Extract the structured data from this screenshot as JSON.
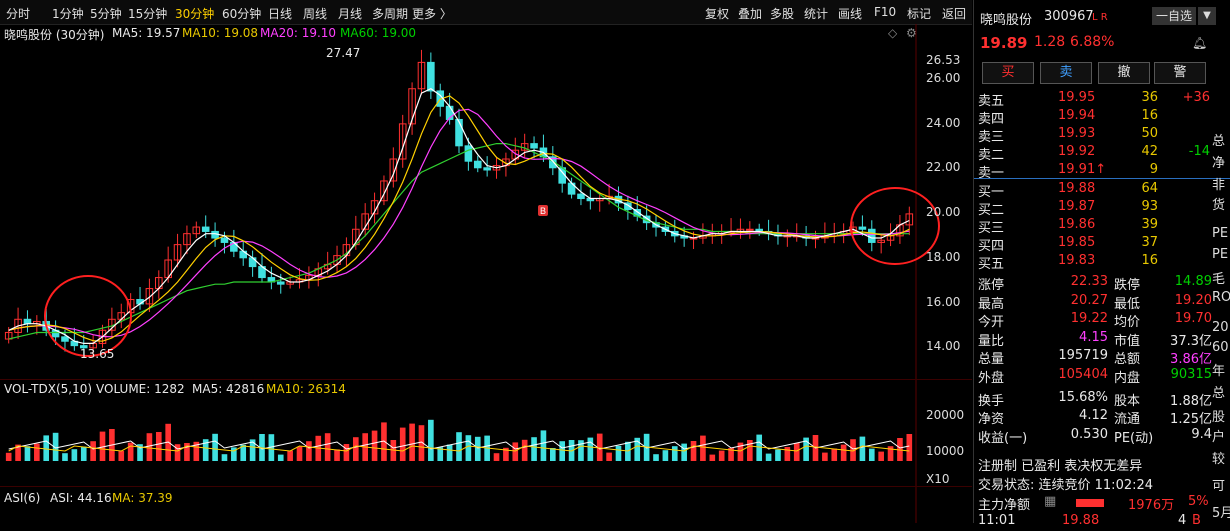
{
  "toolbar": {
    "left": [
      "分时",
      "1分钟",
      "5分钟",
      "15分钟",
      "30分钟",
      "60分钟",
      "日线",
      "周线",
      "月线",
      "多周期",
      "更多 〉"
    ],
    "active": "30分钟",
    "right": [
      "复权",
      "叠加",
      "多股",
      "统计",
      "画线",
      "F10",
      "标记",
      "返回"
    ]
  },
  "main_legend": {
    "title": "晓鸣股份 (30分钟)",
    "ma5": "MA5: 19.57",
    "ma10": "MA10: 19.08",
    "ma20": "MA20: 19.10",
    "ma60": "MA60: 19.00"
  },
  "vol_legend": {
    "name": "VOL-TDX(5,10)",
    "volume": "VOLUME: 1282",
    "ma5": "MA5: 42816",
    "ma10": "MA10: 26314"
  },
  "asi_legend": {
    "name": "ASI(6)",
    "asi": "ASI: 44.16",
    "ma": "MA: 37.39"
  },
  "price_axis": [
    "26.53",
    "26.00",
    "24.00",
    "22.00",
    "20.00",
    "18.00",
    "16.00",
    "14.00"
  ],
  "vol_axis": [
    "20000",
    "10000",
    "X10"
  ],
  "annotations": {
    "high": "27.47",
    "low": "13.65",
    "marker": "B"
  },
  "colors": {
    "up": "#ff3030",
    "down": "#40e0e0",
    "ma5": "#ffffff",
    "ma10": "#ffd000",
    "ma20": "#ff40ff",
    "ma60": "#30d030",
    "circle": "#ff2020"
  },
  "chart_data": {
    "type": "candlestick",
    "timeframe": "30分钟",
    "ylim": [
      13.2,
      27.0
    ],
    "close": [
      14.5,
      15.1,
      14.9,
      15.0,
      14.6,
      14.3,
      14.1,
      13.9,
      13.8,
      14.0,
      14.6,
      15.1,
      15.4,
      16.0,
      15.8,
      16.5,
      17.0,
      17.8,
      18.5,
      19.0,
      19.3,
      19.1,
      18.8,
      18.6,
      18.2,
      17.9,
      17.5,
      17.0,
      16.8,
      16.7,
      16.8,
      16.9,
      17.1,
      17.4,
      17.6,
      18.0,
      18.5,
      19.2,
      19.9,
      20.5,
      21.4,
      22.4,
      24.0,
      25.6,
      26.8,
      25.5,
      24.8,
      24.2,
      23.0,
      22.3,
      22.0,
      21.9,
      22.1,
      22.4,
      22.8,
      23.1,
      22.9,
      22.5,
      22.0,
      21.3,
      20.8,
      20.6,
      20.5,
      20.6,
      20.7,
      20.4,
      20.1,
      19.8,
      19.5,
      19.3,
      19.1,
      18.9,
      18.8,
      18.8,
      18.9,
      19.0,
      19.1,
      19.1,
      19.2,
      19.2,
      19.1,
      19.0,
      18.9,
      18.9,
      18.9,
      18.8,
      18.8,
      18.9,
      19.0,
      19.1,
      19.3,
      19.2,
      18.6,
      18.7,
      18.9,
      19.4,
      19.9
    ],
    "ma5": [
      14.6,
      14.8,
      14.9,
      14.9,
      14.8,
      14.6,
      14.4,
      14.1,
      14.0,
      14.0,
      14.3,
      14.7,
      15.1,
      15.5,
      15.8,
      16.1,
      16.5,
      17.0,
      17.6,
      18.2,
      18.7,
      19.0,
      19.0,
      18.9,
      18.6,
      18.2,
      17.9,
      17.5,
      17.2,
      17.0,
      16.8,
      16.8,
      16.9,
      17.1,
      17.3,
      17.6,
      18.0,
      18.6,
      19.3,
      20.0,
      20.8,
      21.7,
      22.9,
      24.2,
      25.4,
      25.6,
      25.3,
      24.8,
      24.1,
      23.2,
      22.6,
      22.1,
      22.0,
      22.1,
      22.4,
      22.7,
      22.8,
      22.7,
      22.3,
      21.8,
      21.3,
      20.9,
      20.6,
      20.6,
      20.6,
      20.5,
      20.3,
      20.0,
      19.7,
      19.4,
      19.2,
      19.0,
      18.9,
      18.8,
      18.9,
      19.0,
      19.0,
      19.1,
      19.1,
      19.1,
      19.1,
      19.0,
      18.9,
      18.9,
      18.9,
      18.8,
      18.8,
      18.9,
      19.0,
      19.1,
      19.2,
      19.0,
      18.8,
      18.8,
      19.0,
      19.4,
      19.6
    ],
    "ma60": [
      14.2,
      14.3,
      14.4,
      14.5,
      14.5,
      14.5,
      14.5,
      14.5,
      14.5,
      14.6,
      14.7,
      14.8,
      15.0,
      15.2,
      15.4,
      15.6,
      15.8,
      16.0,
      16.2,
      16.4,
      16.5,
      16.6,
      16.7,
      16.7,
      16.8,
      16.8,
      16.8,
      16.8,
      16.8,
      16.9,
      17.0,
      17.1,
      17.2,
      17.4,
      17.6,
      17.8,
      18.1,
      18.5,
      18.9,
      19.4,
      19.9,
      20.4,
      20.9,
      21.4,
      21.8,
      22.0,
      22.2,
      22.4,
      22.6,
      22.8,
      22.9,
      23.0,
      23.1,
      23.1,
      23.0,
      22.9,
      22.7,
      22.5,
      22.3,
      22.0,
      21.7,
      21.4,
      21.1,
      20.8,
      20.5,
      20.2,
      20.0,
      19.8,
      19.6,
      19.5,
      19.4,
      19.3,
      19.2,
      19.2,
      19.2,
      19.1,
      19.1,
      19.1,
      19.1,
      19.0,
      19.0,
      19.0,
      19.0,
      19.0,
      19.0,
      19.0,
      19.0,
      19.0,
      19.0,
      19.0,
      19.0,
      19.0,
      19.0,
      19.0,
      19.0,
      19.0,
      19.0
    ]
  },
  "quote": {
    "name": "晓鸣股份",
    "code": "300967",
    "flags": "L R",
    "self_select": "一自选",
    "price": "19.89",
    "change": "1.28",
    "pct": "6.88%",
    "buttons": [
      "买",
      "卖",
      "撤",
      "警"
    ],
    "asks": [
      {
        "label": "卖五",
        "price": "19.95",
        "vol": "36",
        "chg": "+36"
      },
      {
        "label": "卖四",
        "price": "19.94",
        "vol": "16",
        "chg": ""
      },
      {
        "label": "卖三",
        "price": "19.93",
        "vol": "50",
        "chg": ""
      },
      {
        "label": "卖二",
        "price": "19.92",
        "vol": "42",
        "chg": "-14"
      },
      {
        "label": "卖一",
        "price": "19.91↑",
        "vol": "9",
        "chg": ""
      }
    ],
    "bids": [
      {
        "label": "买一",
        "price": "19.88",
        "vol": "64"
      },
      {
        "label": "买二",
        "price": "19.87",
        "vol": "93"
      },
      {
        "label": "买三",
        "price": "19.86",
        "vol": "39"
      },
      {
        "label": "买四",
        "price": "19.85",
        "vol": "37"
      },
      {
        "label": "买五",
        "price": "19.83",
        "vol": "16"
      }
    ],
    "stats": [
      [
        "涨停",
        "22.33",
        "跌停",
        "14.89"
      ],
      [
        "最高",
        "20.27",
        "最低",
        "19.20"
      ],
      [
        "今开",
        "19.22",
        "均价",
        "19.70"
      ],
      [
        "量比",
        "4.15",
        "市值",
        "37.3亿"
      ],
      [
        "总量",
        "195719",
        "总额",
        "3.86亿"
      ],
      [
        "外盘",
        "105404",
        "内盘",
        "90315"
      ],
      [
        "换手",
        "15.68%",
        "股本",
        "1.88亿"
      ],
      [
        "净资",
        "4.12",
        "流通",
        "1.25亿"
      ],
      [
        "收益(一)",
        "0.530",
        "PE(动)",
        "9.4"
      ]
    ],
    "tags": "注册制 已盈利 表决权无差异",
    "status": "交易状态: 连续竞价 11:02:24",
    "net_flow": {
      "label": "主力净额",
      "value": "1976万",
      "pct": "5%"
    },
    "tick": {
      "time": "11:01",
      "price": "19.88",
      "vol": "4",
      "side": "B"
    },
    "edge_text": [
      "总",
      "净",
      "非",
      "货",
      "PE",
      "PE",
      "毛",
      "RO",
      "20",
      "60",
      "年",
      "总",
      "股",
      "户",
      "较",
      "可",
      "5月"
    ]
  }
}
